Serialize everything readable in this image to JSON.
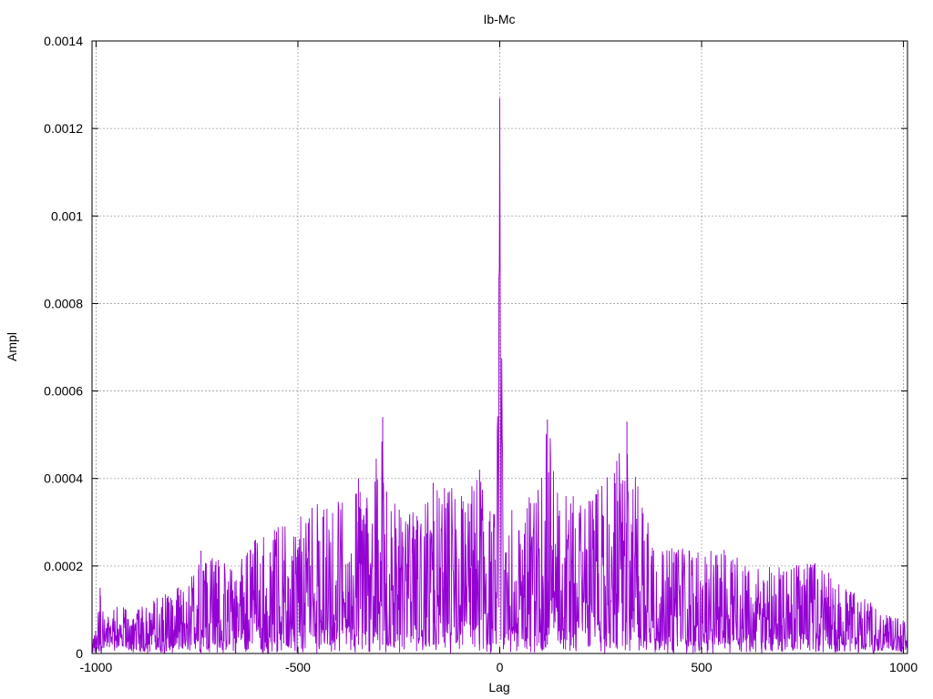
{
  "chart_data": {
    "type": "line",
    "title": "Ib-Mc",
    "xlabel": "Lag",
    "ylabel": "Ampl",
    "xlim": [
      -1010,
      1010
    ],
    "ylim": [
      0,
      0.0014
    ],
    "x_ticks": [
      -1000,
      -500,
      0,
      500,
      1000
    ],
    "x_tick_labels": [
      "-1000",
      "-500",
      "0",
      "500",
      "1000"
    ],
    "y_ticks": [
      0,
      0.0002,
      0.0004,
      0.0006,
      0.0008,
      0.001,
      0.0012,
      0.0014
    ],
    "y_tick_labels": [
      "0",
      "0.0002",
      "0.0004",
      "0.0006",
      "0.0008",
      "0.001",
      "0.0012",
      "0.0014"
    ],
    "grid": true,
    "line_color": "#9400d3",
    "series": [
      {
        "x_range": [
          -1010,
          1010
        ],
        "points_estimated": [
          [
            -1010,
            3e-05
          ],
          [
            -1000,
            6e-05
          ],
          [
            -990,
            0.00015
          ],
          [
            -980,
            8e-05
          ],
          [
            -950,
            0.00011
          ],
          [
            -900,
            0.0001
          ],
          [
            -850,
            0.00013
          ],
          [
            -800,
            0.00015
          ],
          [
            -770,
            0.00016
          ],
          [
            -740,
            0.00023
          ],
          [
            -700,
            0.00022
          ],
          [
            -650,
            0.0002
          ],
          [
            -600,
            0.00028
          ],
          [
            -550,
            0.00029
          ],
          [
            -500,
            0.00032
          ],
          [
            -450,
            0.00035
          ],
          [
            -400,
            0.00035
          ],
          [
            -350,
            0.0004
          ],
          [
            -325,
            0.00037
          ],
          [
            -290,
            0.00054
          ],
          [
            -280,
            0.00037
          ],
          [
            -250,
            0.00033
          ],
          [
            -200,
            0.00032
          ],
          [
            -165,
            0.00039
          ],
          [
            -150,
            0.00038
          ],
          [
            -100,
            0.00038
          ],
          [
            -50,
            0.00042
          ],
          [
            -10,
            0.00033
          ],
          [
            -2,
            0.00089
          ],
          [
            0,
            0.00127
          ],
          [
            2,
            0.00087
          ],
          [
            10,
            0.00035
          ],
          [
            50,
            0.00035
          ],
          [
            100,
            0.00038
          ],
          [
            118,
            0.00054
          ],
          [
            150,
            0.00038
          ],
          [
            200,
            0.00035
          ],
          [
            250,
            0.00038
          ],
          [
            290,
            0.00044
          ],
          [
            315,
            0.00053
          ],
          [
            350,
            0.00036
          ],
          [
            400,
            0.00026
          ],
          [
            450,
            0.00025
          ],
          [
            500,
            0.00023
          ],
          [
            550,
            0.00024
          ],
          [
            600,
            0.00022
          ],
          [
            650,
            0.0002
          ],
          [
            700,
            0.0002
          ],
          [
            750,
            0.00022
          ],
          [
            800,
            0.0002
          ],
          [
            850,
            0.00015
          ],
          [
            900,
            0.00014
          ],
          [
            950,
            9e-05
          ],
          [
            990,
            8e-05
          ],
          [
            1010,
            7e-05
          ]
        ]
      }
    ]
  }
}
